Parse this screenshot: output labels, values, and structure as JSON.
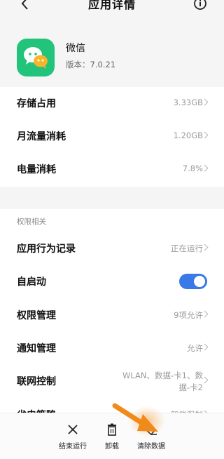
{
  "header": {
    "title": "应用详情"
  },
  "app": {
    "name": "微信",
    "version": "版本：7.0.21"
  },
  "usage": [
    {
      "label": "存储占用",
      "value": "3.33GB"
    },
    {
      "label": "月流量消耗",
      "value": "1.20GB"
    },
    {
      "label": "电量消耗",
      "value": "7.8%"
    }
  ],
  "permissions": {
    "header": "权限相关",
    "items": [
      {
        "label": "应用行为记录",
        "value": "正在运行"
      },
      {
        "label": "自启动",
        "toggle": true
      },
      {
        "label": "权限管理",
        "value": "9项允许"
      },
      {
        "label": "通知管理",
        "value": "允许"
      },
      {
        "label": "联网控制",
        "value_line1": "WLAN、数据-卡1、数",
        "value_line2": "据-卡2"
      },
      {
        "label": "省电策略",
        "value": "智能限制"
      }
    ]
  },
  "bottom": {
    "force_stop": "结束运行",
    "uninstall": "卸载",
    "clear_data": "清除数据"
  },
  "colors": {
    "accent": "#3a79e8",
    "app_icon": "#22c37a",
    "arrow": "#f08a1a"
  }
}
